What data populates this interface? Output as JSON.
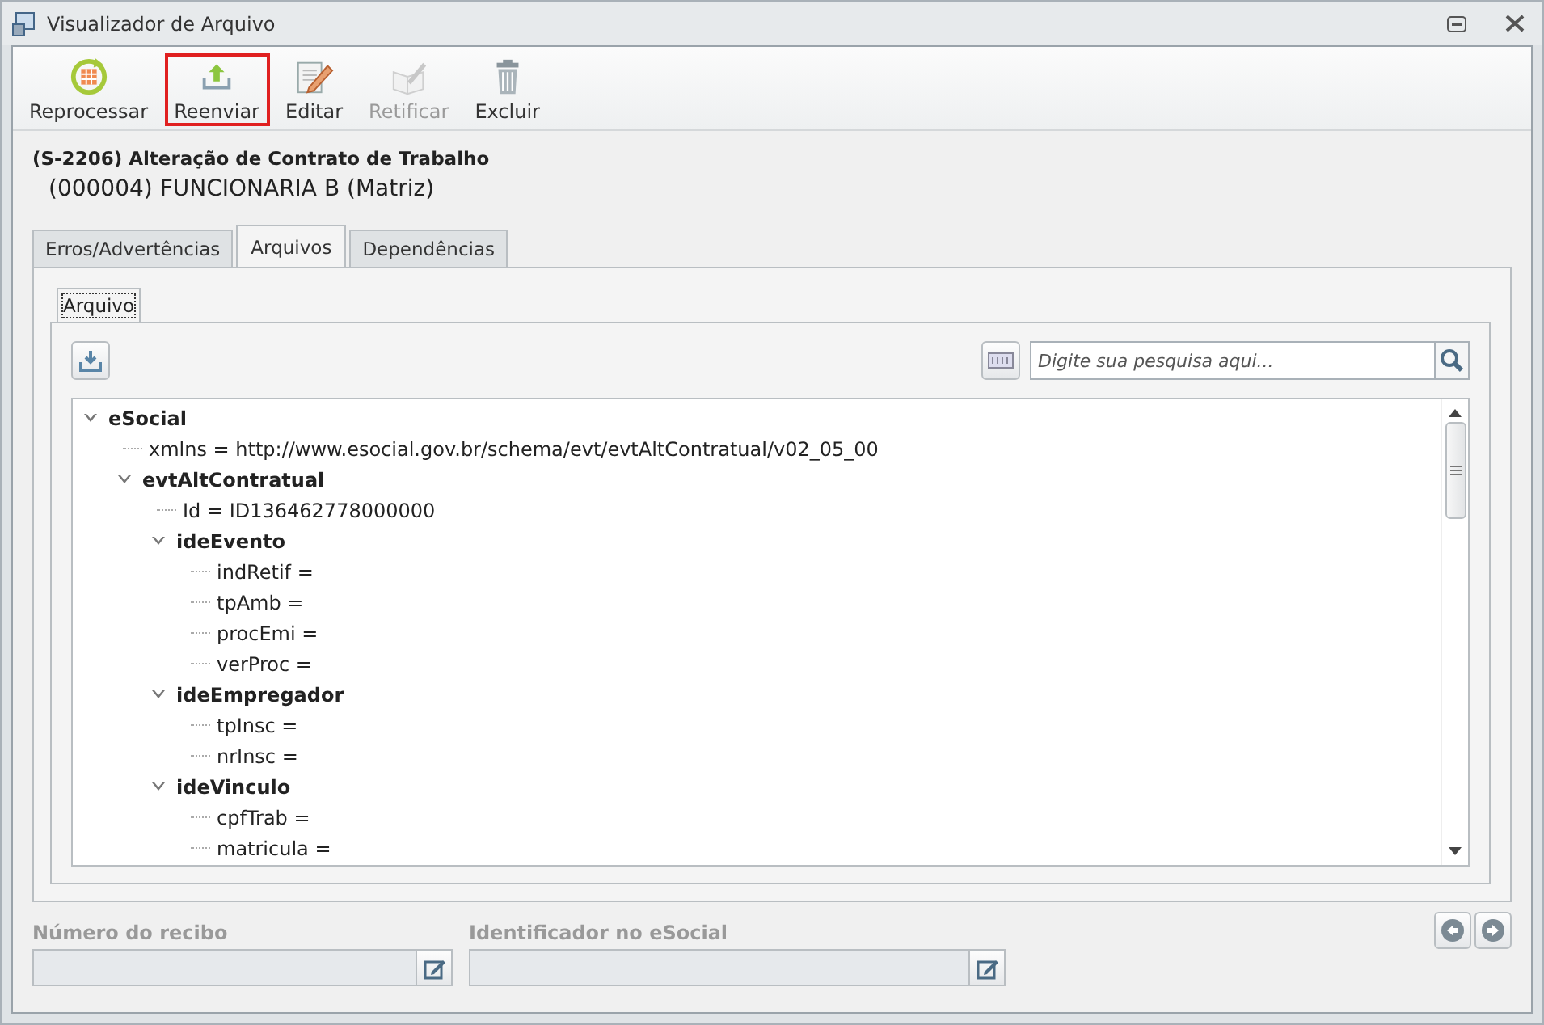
{
  "window": {
    "title": "Visualizador de Arquivo"
  },
  "toolbar": [
    {
      "label": "Reprocessar",
      "kind": "refresh",
      "disabled": false,
      "highlighted": false
    },
    {
      "label": "Reenviar",
      "kind": "upload",
      "disabled": false,
      "highlighted": true
    },
    {
      "label": "Editar",
      "kind": "edit",
      "disabled": false,
      "highlighted": false
    },
    {
      "label": "Retificar",
      "kind": "rectify",
      "disabled": true,
      "highlighted": false
    },
    {
      "label": "Excluir",
      "kind": "trash",
      "disabled": false,
      "highlighted": false
    }
  ],
  "event_title": "(S-2206) Alteração de Contrato de Trabalho",
  "employee": "(000004) FUNCIONARIA B (Matriz)",
  "tabs": [
    {
      "label": "Erros/Advertências",
      "selected": false
    },
    {
      "label": "Arquivos",
      "selected": true
    },
    {
      "label": "Dependências",
      "selected": false
    }
  ],
  "inner_tabs": [
    {
      "label": "Arquivo",
      "selected": true
    }
  ],
  "search": {
    "placeholder": "Digite sua pesquisa aqui..."
  },
  "tree": [
    {
      "label": "eSocial",
      "expanded": true,
      "children": [
        {
          "label": "xmlns = http://www.esocial.gov.br/schema/evt/evtAltContratual/v02_05_00"
        },
        {
          "label": "evtAltContratual",
          "expanded": true,
          "children": [
            {
              "label": "Id = ID136462778000000"
            },
            {
              "label": "ideEvento",
              "expanded": true,
              "children": [
                {
                  "label": "indRetif ="
                },
                {
                  "label": "tpAmb ="
                },
                {
                  "label": "procEmi ="
                },
                {
                  "label": "verProc ="
                }
              ]
            },
            {
              "label": "ideEmpregador",
              "expanded": true,
              "children": [
                {
                  "label": "tpInsc ="
                },
                {
                  "label": "nrInsc ="
                }
              ]
            },
            {
              "label": "ideVinculo",
              "expanded": true,
              "children": [
                {
                  "label": "cpfTrab ="
                },
                {
                  "label": "matricula ="
                }
              ]
            }
          ]
        }
      ]
    }
  ],
  "footer_fields": [
    {
      "label": "Número do recibo"
    },
    {
      "label": "Identificador no eSocial"
    }
  ]
}
